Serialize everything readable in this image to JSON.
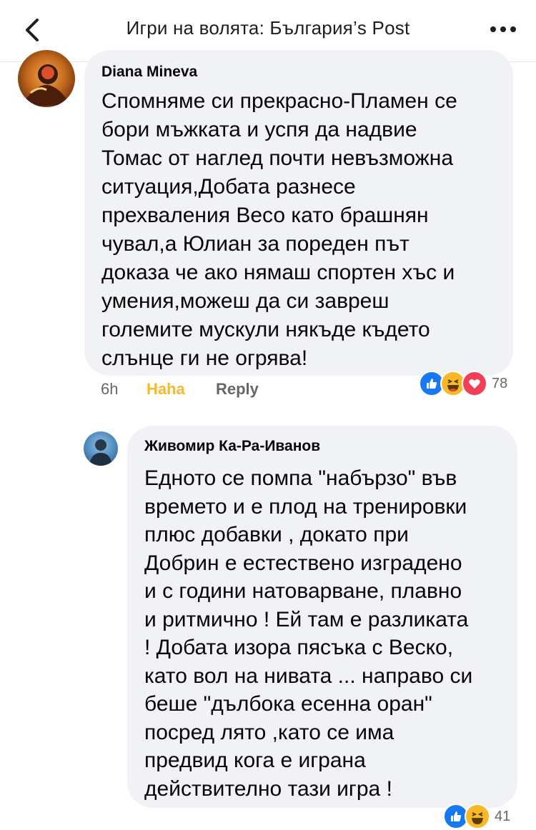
{
  "header": {
    "title": "Игри на волята: България’s Post"
  },
  "comments": [
    {
      "author": "Diana Mineva",
      "text": "Спомняме си прекрасно-Пламен се\nбори мъжката и успя да надвие\nТомас от наглед почти невъзможна\nситуация,Добата разнесе\nпрехваления Весо като брашнян\nчувал,а Юлиан за пореден път\nдоказа че ако нямаш спортен хъс и\nумения,можеш да си завреш\nголемите мускули някъде където\nслънце ги не огрява!",
      "time": "6h",
      "reaction_label": "Haha",
      "reply_label": "Reply",
      "reaction_count": "78"
    },
    {
      "author": "Живомир Ка-Ра-Иванов",
      "text": "Едното се помпа \"набързо\" във\nвремето и е плод на тренировки\nплюс добавки , докато при\nДобрин е естествено изградено\nи с години натоварване, плавно\nи ритмично ! Ей там е разликата\n! Добата изора пясъка с Веско,\nкато вол на нивата ... направо си\nбеше \"дълбока есенна оран\"\nпосред лято ,като се има\nпредвид кога е играна\nдействително тази игра !",
      "reaction_count": "41"
    }
  ],
  "colors": {
    "bubble": "#f0f2f5",
    "haha": "#f7b928",
    "like": "#1877f2",
    "love": "#f33e58"
  },
  "icons": [
    "back-arrow-icon",
    "more-options-icon",
    "like-reaction-icon",
    "haha-reaction-icon",
    "love-reaction-icon"
  ]
}
